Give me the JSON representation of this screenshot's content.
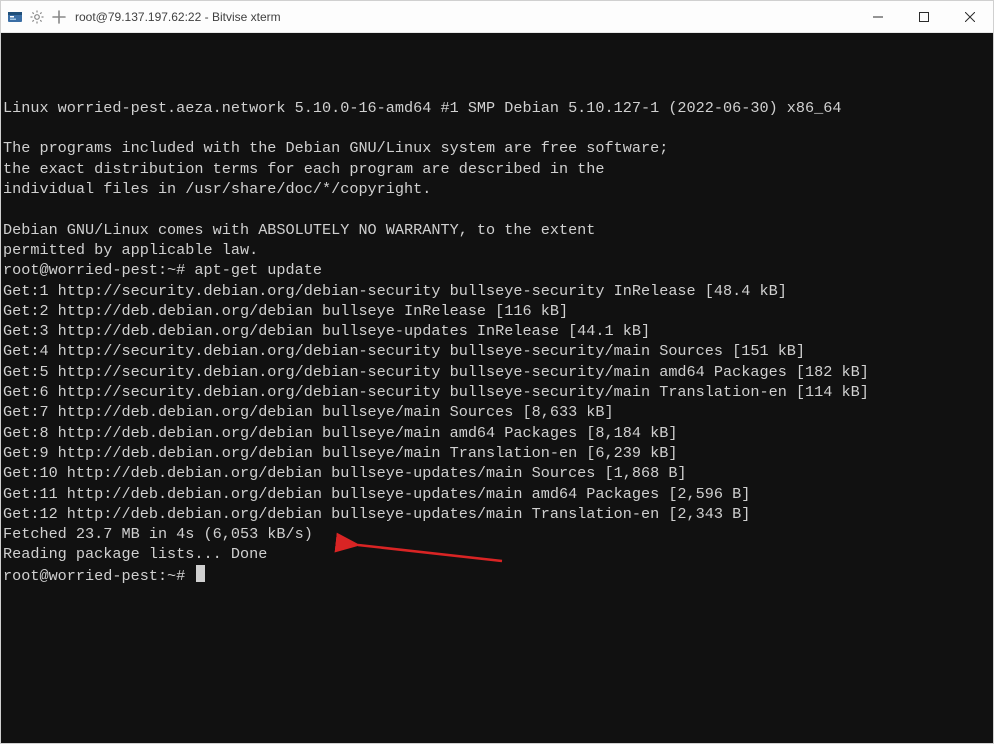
{
  "window": {
    "title": "root@79.137.197.62:22 - Bitvise xterm"
  },
  "terminal": {
    "lines": [
      "Linux worried-pest.aeza.network 5.10.0-16-amd64 #1 SMP Debian 5.10.127-1 (2022-06-30) x86_64",
      "",
      "The programs included with the Debian GNU/Linux system are free software;",
      "the exact distribution terms for each program are described in the",
      "individual files in /usr/share/doc/*/copyright.",
      "",
      "Debian GNU/Linux comes with ABSOLUTELY NO WARRANTY, to the extent",
      "permitted by applicable law.",
      "root@worried-pest:~# apt-get update",
      "Get:1 http://security.debian.org/debian-security bullseye-security InRelease [48.4 kB]",
      "Get:2 http://deb.debian.org/debian bullseye InRelease [116 kB]",
      "Get:3 http://deb.debian.org/debian bullseye-updates InRelease [44.1 kB]",
      "Get:4 http://security.debian.org/debian-security bullseye-security/main Sources [151 kB]",
      "Get:5 http://security.debian.org/debian-security bullseye-security/main amd64 Packages [182 kB]",
      "Get:6 http://security.debian.org/debian-security bullseye-security/main Translation-en [114 kB]",
      "Get:7 http://deb.debian.org/debian bullseye/main Sources [8,633 kB]",
      "Get:8 http://deb.debian.org/debian bullseye/main amd64 Packages [8,184 kB]",
      "Get:9 http://deb.debian.org/debian bullseye/main Translation-en [6,239 kB]",
      "Get:10 http://deb.debian.org/debian bullseye-updates/main Sources [1,868 B]",
      "Get:11 http://deb.debian.org/debian bullseye-updates/main amd64 Packages [2,596 B]",
      "Get:12 http://deb.debian.org/debian bullseye-updates/main Translation-en [2,343 B]",
      "Fetched 23.7 MB in 4s (6,053 kB/s)",
      "Reading package lists... Done"
    ],
    "prompt": "root@worried-pest:~# "
  },
  "annotation": {
    "color": "#d92424"
  }
}
